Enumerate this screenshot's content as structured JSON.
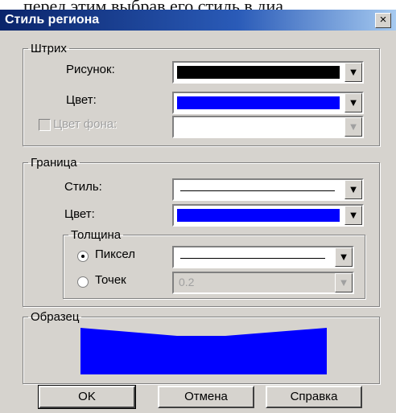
{
  "caption": ", перед этим выбрав его стиль в диа",
  "window": {
    "title": "Стиль региона",
    "close_glyph": "×"
  },
  "stroke": {
    "legend": "Штрих",
    "pattern_label": "Рисунок:",
    "color_label": "Цвет:",
    "bg_color_label": "Цвет фона:",
    "bg_color_checked": false,
    "pattern_color": "#000000",
    "color": "#0000ff"
  },
  "border": {
    "legend": "Граница",
    "style_label": "Стиль:",
    "color_label": "Цвет:",
    "color": "#0000ff",
    "thickness": {
      "legend": "Толщина",
      "pixel_label": "Пиксел",
      "points_label": "Точек",
      "points_value": "0.2",
      "selected": "pixel"
    }
  },
  "sample": {
    "legend": "Образец",
    "color": "#0000ff"
  },
  "buttons": {
    "ok": "OK",
    "cancel": "Отмена",
    "help": "Справка"
  },
  "icons": {
    "dropdown": "dropdown-arrow-icon",
    "close": "close-icon"
  }
}
